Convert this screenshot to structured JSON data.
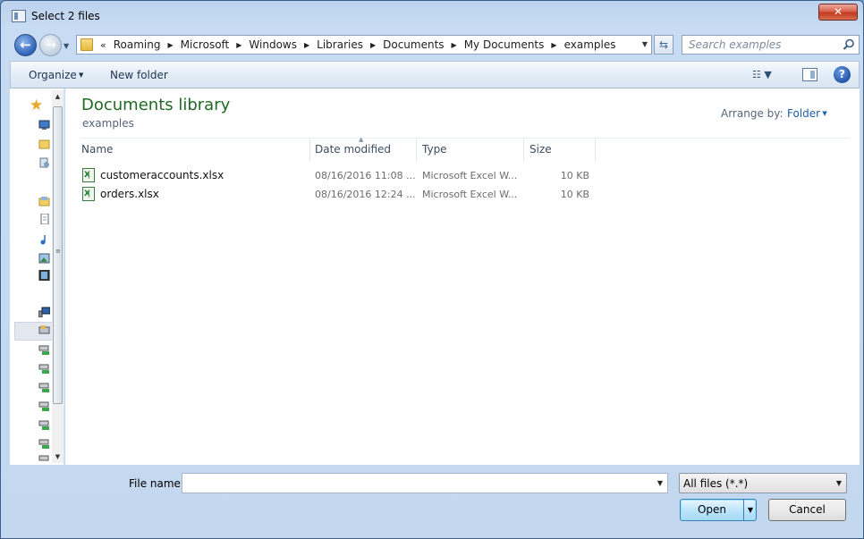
{
  "window": {
    "title": "Select 2 files",
    "close_glyph": "✕"
  },
  "nav": {
    "back_glyph": "←",
    "forward_glyph": "→",
    "refresh_glyph": "⇆"
  },
  "address": {
    "lead": "«",
    "crumbs": [
      "Roaming",
      "Microsoft",
      "Windows",
      "Libraries",
      "Documents",
      "My Documents",
      "examples"
    ],
    "sep_glyph": "▶"
  },
  "search": {
    "placeholder": "Search examples"
  },
  "toolbar": {
    "organize": "Organize",
    "new_folder": "New folder",
    "view_glyph": "☷ ▼",
    "help_glyph": "?"
  },
  "library": {
    "title": "Documents library",
    "subtitle": "examples",
    "arrange_label": "Arrange by:",
    "arrange_value": "Folder"
  },
  "columns": {
    "name": "Name",
    "date": "Date modified",
    "type": "Type",
    "size": "Size"
  },
  "files": [
    {
      "name": "customeraccounts.xlsx",
      "date": "08/16/2016 11:08 ...",
      "type": "Microsoft Excel W...",
      "size": "10 KB"
    },
    {
      "name": "orders.xlsx",
      "date": "08/16/2016 12:24 ...",
      "type": "Microsoft Excel W...",
      "size": "10 KB"
    }
  ],
  "bottom": {
    "file_name_label": "File name:",
    "file_name_value": "",
    "filter_value": "All files (*.*)",
    "open_label": "Open",
    "cancel_label": "Cancel"
  },
  "icons": {
    "nav_pane": [
      "star-icon",
      "desktop-icon",
      "folder-icon",
      "recent-places-icon",
      "libraries-icon",
      "documents-icon",
      "music-icon",
      "pictures-icon",
      "videos-icon",
      "computer-icon",
      "local-disk-icon",
      "network-drive-icon"
    ]
  },
  "colors": {
    "library_title": "#1e6a23",
    "accent_link": "#1f5ea8",
    "close": "#c23a1f"
  }
}
